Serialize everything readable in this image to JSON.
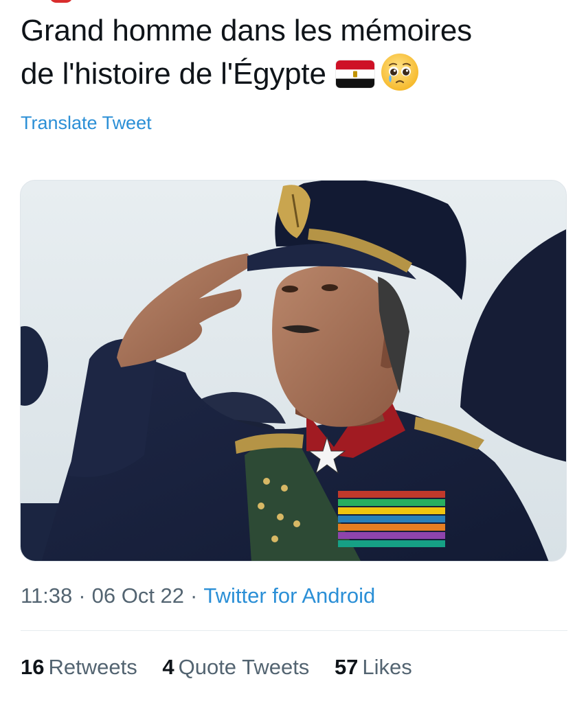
{
  "tweet": {
    "text_line_1": "Grand homme dans les mémoires",
    "text_line_2": "de l'histoire de l'Égypte",
    "emoji_1": "egypt-flag-emoji",
    "emoji_2": "crying-face-emoji",
    "translate_label": "Translate Tweet"
  },
  "media": {
    "icon": "photo"
  },
  "meta": {
    "time": "11:38",
    "date": "06 Oct 22",
    "separator": "·",
    "source": "Twitter for Android"
  },
  "stats": {
    "retweets_count": "16",
    "retweets_label": "Retweets",
    "quotes_count": "4",
    "quotes_label": "Quote Tweets",
    "likes_count": "57",
    "likes_label": "Likes"
  },
  "colors": {
    "link": "#2b8fd6",
    "text": "#0f1419",
    "secondary": "#536471"
  }
}
